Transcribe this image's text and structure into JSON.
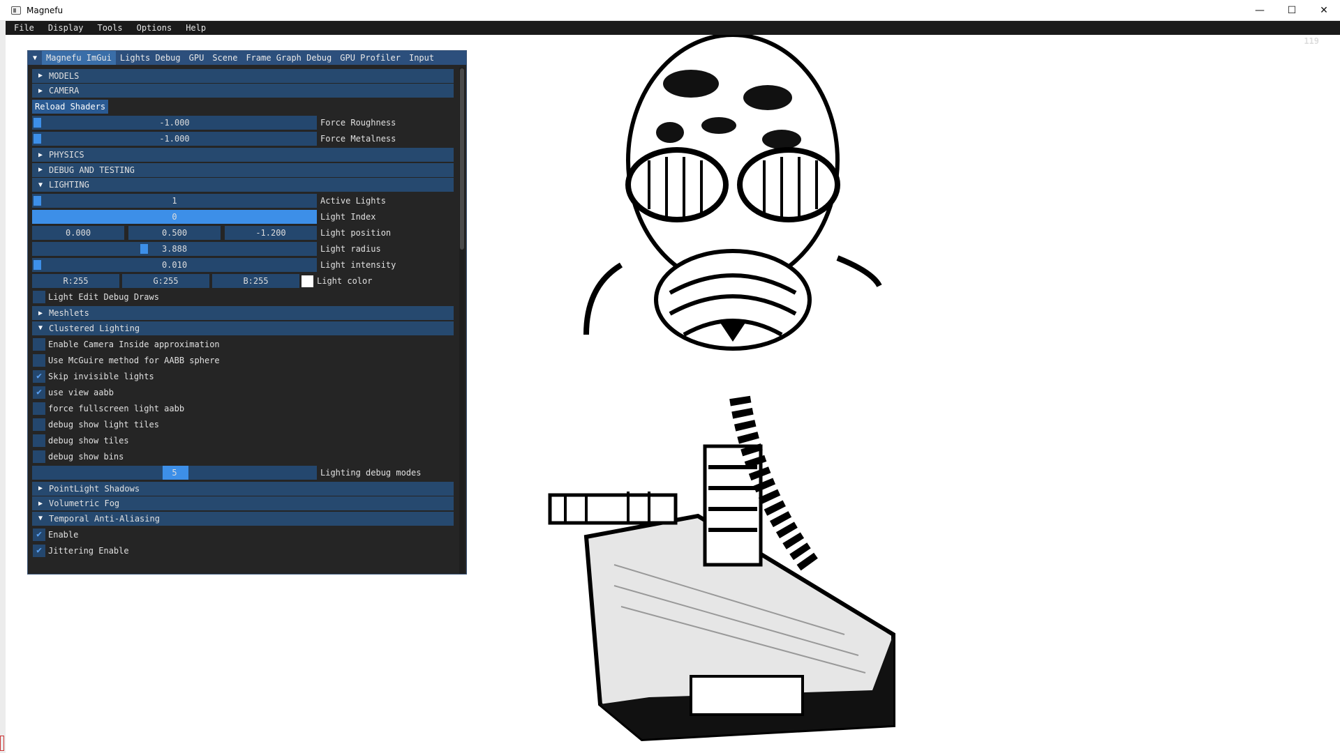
{
  "window": {
    "title": "Magnefu",
    "minimize": "—",
    "maximize": "☐",
    "close": "✕"
  },
  "menu": [
    "File",
    "Display",
    "Tools",
    "Options",
    "Help"
  ],
  "fps": "119",
  "imgui": {
    "tabs": [
      "Magnefu ImGui",
      "Lights Debug",
      "GPU",
      "Scene",
      "Frame Graph Debug",
      "GPU Profiler",
      "Input"
    ],
    "headers": {
      "models": "MODELS",
      "camera": "CAMERA",
      "physics": "PHYSICS",
      "debug": "DEBUG AND TESTING",
      "lighting": "LIGHTING",
      "meshlets": "Meshlets",
      "clustered": "Clustered Lighting",
      "pointlight": "PointLight Shadows",
      "fog": "Volumetric Fog",
      "taa": "Temporal Anti-Aliasing"
    },
    "reload_shaders": "Reload Shaders",
    "force_roughness": {
      "value": "-1.000",
      "label": "Force Roughness"
    },
    "force_metalness": {
      "value": "-1.000",
      "label": "Force Metalness"
    },
    "active_lights": {
      "value": "1",
      "label": "Active Lights"
    },
    "light_index": {
      "value": "0",
      "label": "Light Index"
    },
    "light_position": {
      "x": "0.000",
      "y": "0.500",
      "z": "-1.200",
      "label": "Light position"
    },
    "light_radius": {
      "value": "3.888",
      "label": "Light radius"
    },
    "light_intensity": {
      "value": "0.010",
      "label": "Light intensity"
    },
    "light_color": {
      "r": "R:255",
      "g": "G:255",
      "b": "B:255",
      "label": "Light color",
      "swatch": "#ffffff"
    },
    "light_edit_debug": "Light Edit Debug Draws",
    "clustered_options": [
      {
        "label": "Enable Camera Inside approximation",
        "checked": false
      },
      {
        "label": "Use McGuire method for AABB sphere",
        "checked": false
      },
      {
        "label": "Skip invisible lights",
        "checked": true
      },
      {
        "label": "use view aabb",
        "checked": true
      },
      {
        "label": "force fullscreen light aabb",
        "checked": false
      },
      {
        "label": "debug show light tiles",
        "checked": false
      },
      {
        "label": "debug show tiles",
        "checked": false
      },
      {
        "label": "debug show bins",
        "checked": false
      }
    ],
    "lighting_debug_modes": {
      "value": "5",
      "label": "Lighting debug modes"
    },
    "taa_enable": "Enable",
    "taa_jitter": "Jittering Enable",
    "check_mark": "✔"
  },
  "colors": {
    "imgui_bg": "#252525",
    "header": "#26496f",
    "accent": "#3d8fe8",
    "menubar": "#1a1a1a"
  }
}
